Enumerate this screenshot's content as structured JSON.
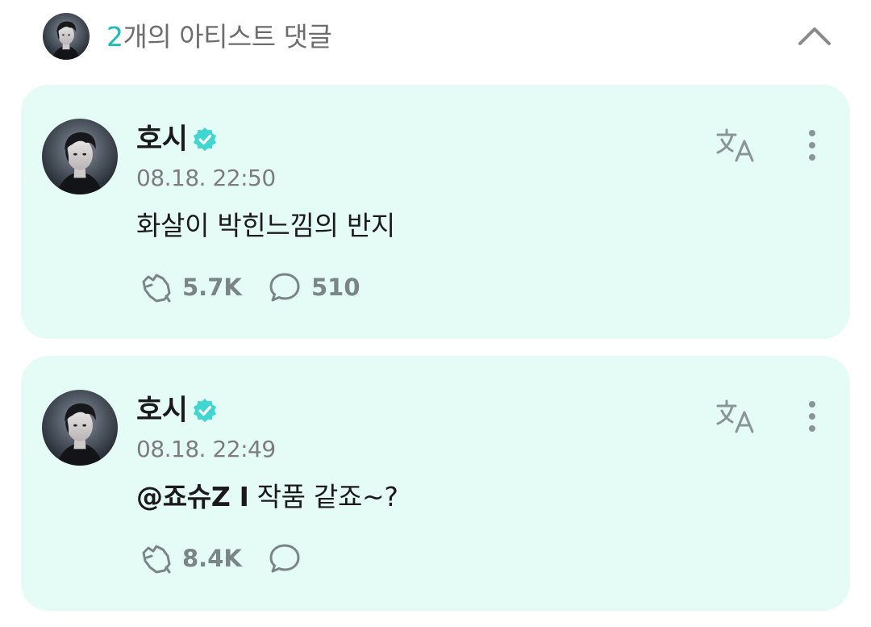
{
  "header": {
    "count": "2",
    "title_suffix": "개의 아티스트 댓글",
    "avatar": "artist-avatar"
  },
  "comments": [
    {
      "author": "호시",
      "verified": true,
      "timestamp": "08.18. 22:50",
      "mention": "",
      "text": "화살이 박힌느낌의 반지",
      "cheer_count": "5.7K",
      "reply_count": "510"
    },
    {
      "author": "호시",
      "verified": true,
      "timestamp": "08.18. 22:49",
      "mention": "@죠슈Z I",
      "text": "작품 같죠~?",
      "cheer_count": "8.4K",
      "reply_count": ""
    }
  ],
  "icons": {
    "collapse": "chevron-up-icon",
    "verified": "verified-badge-icon",
    "translate": "translate-icon",
    "more": "more-vertical-icon",
    "cheer": "cheer-hand-icon",
    "reply": "speech-bubble-icon"
  },
  "colors": {
    "accent": "#14bfba",
    "card_bg": "#e5fcf6",
    "verified": "#3fd6cf",
    "icon_gray": "#7a8585"
  }
}
